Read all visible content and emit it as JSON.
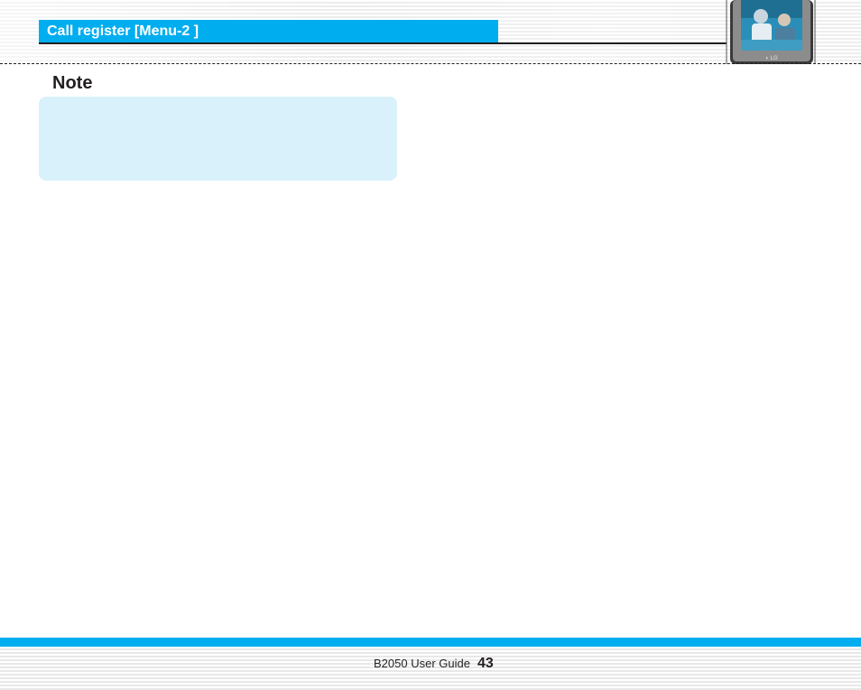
{
  "header": {
    "section_title": "Call register [Menu-2 ]"
  },
  "note": {
    "heading": "Note"
  },
  "footer": {
    "guide_label": "B2050 User Guide",
    "page_number": "43"
  },
  "colors": {
    "accent": "#00aef0",
    "note_background": "#d9f1fb",
    "text": "#231f20"
  }
}
